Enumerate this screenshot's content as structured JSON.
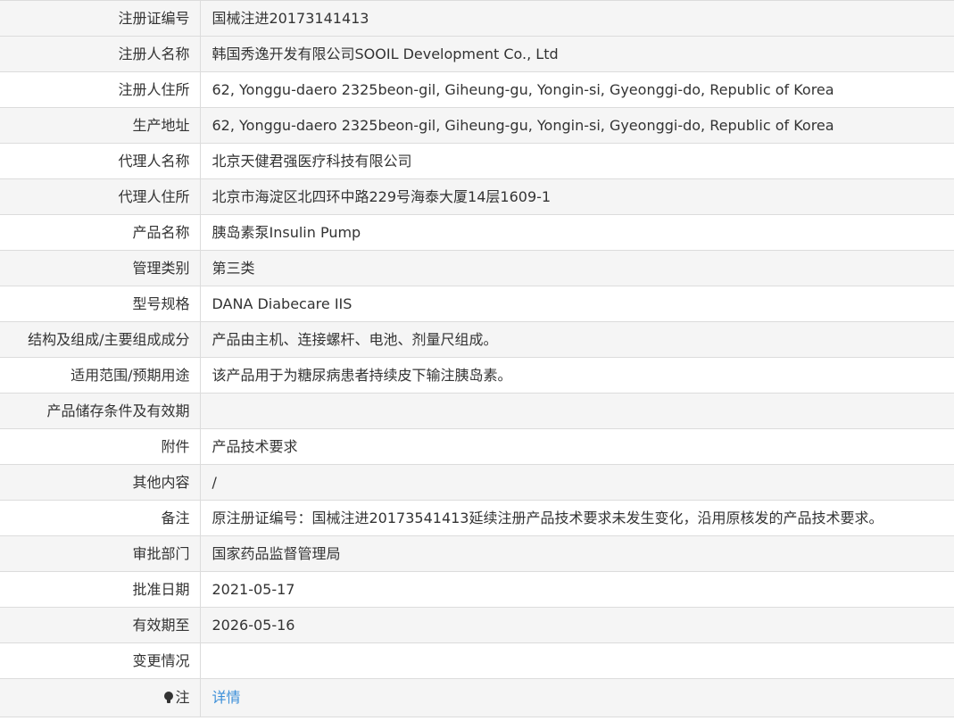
{
  "rows": [
    {
      "label": "注册证编号",
      "value": "国械注进20173141413"
    },
    {
      "label": "注册人名称",
      "value": "韩国秀逸开发有限公司SOOIL Development Co., Ltd"
    },
    {
      "label": "注册人住所",
      "value": "62, Yonggu-daero 2325beon-gil, Giheung-gu, Yongin-si, Gyeonggi-do, Republic of Korea"
    },
    {
      "label": "生产地址",
      "value": "62, Yonggu-daero 2325beon-gil, Giheung-gu, Yongin-si, Gyeonggi-do, Republic of Korea"
    },
    {
      "label": "代理人名称",
      "value": "北京天健君强医疗科技有限公司"
    },
    {
      "label": "代理人住所",
      "value": "北京市海淀区北四环中路229号海泰大厦14层1609-1"
    },
    {
      "label": "产品名称",
      "value": "胰岛素泵Insulin Pump"
    },
    {
      "label": "管理类别",
      "value": "第三类"
    },
    {
      "label": "型号规格",
      "value": "DANA Diabecare IIS"
    },
    {
      "label": "结构及组成/主要组成成分",
      "value": "产品由主机、连接螺杆、电池、剂量尺组成。"
    },
    {
      "label": "适用范围/预期用途",
      "value": "该产品用于为糖尿病患者持续皮下输注胰岛素。"
    },
    {
      "label": "产品储存条件及有效期",
      "value": ""
    },
    {
      "label": "附件",
      "value": "产品技术要求"
    },
    {
      "label": "其他内容",
      "value": "/"
    },
    {
      "label": "备注",
      "value": "原注册证编号：国械注进20173541413延续注册产品技术要求未发生变化，沿用原核发的产品技术要求。"
    },
    {
      "label": "审批部门",
      "value": "国家药品监督管理局"
    },
    {
      "label": "批准日期",
      "value": "2021-05-17"
    },
    {
      "label": "有效期至",
      "value": "2026-05-16"
    },
    {
      "label": "变更情况",
      "value": ""
    }
  ],
  "note_row": {
    "icon": "lightbulb-icon",
    "label": "注",
    "link_text": "详情"
  },
  "colors": {
    "link": "#3b8fd9",
    "odd_row_bg": "#f5f5f5",
    "border": "#dcdcdc"
  }
}
